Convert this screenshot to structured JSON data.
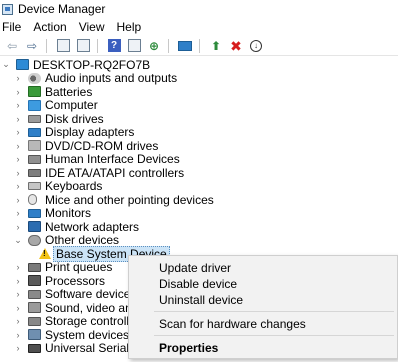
{
  "window": {
    "title": "Device Manager"
  },
  "menubar": {
    "items": [
      "File",
      "Action",
      "View",
      "Help"
    ]
  },
  "toolbar": {
    "buttons": [
      "back-icon",
      "forward-icon",
      "show-hide-tree-icon",
      "properties-icon",
      "help-icon",
      "refresh-icon",
      "scan-hardware-icon",
      "update-driver-icon",
      "uninstall-icon",
      "disable-icon"
    ]
  },
  "tree": {
    "root": "DESKTOP-RQ2FO7B",
    "categories": [
      "Audio inputs and outputs",
      "Batteries",
      "Computer",
      "Disk drives",
      "Display adapters",
      "DVD/CD-ROM drives",
      "Human Interface Devices",
      "IDE ATA/ATAPI controllers",
      "Keyboards",
      "Mice and other pointing devices",
      "Monitors",
      "Network adapters",
      "Other devices",
      "Base System Device",
      "Print queues",
      "Processors",
      "Software devices",
      "Sound, video and gam",
      "Storage controllers",
      "System devices",
      "Universal Serial Bus cc"
    ]
  },
  "context_menu": {
    "items": [
      "Update driver",
      "Disable device",
      "Uninstall device",
      "Scan for hardware changes",
      "Properties"
    ]
  }
}
